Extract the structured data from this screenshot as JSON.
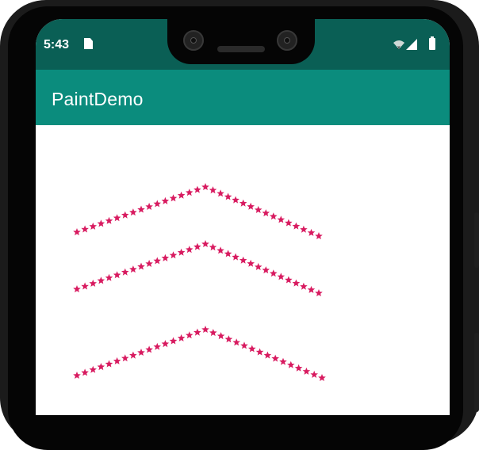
{
  "status_bar": {
    "time": "5:43",
    "icons": [
      "sim-card-icon",
      "wifi-icon",
      "signal-icon",
      "battery-icon"
    ]
  },
  "app_bar": {
    "title": "PaintDemo",
    "color": "#0b8c7d",
    "status_color": "#0a5f55"
  },
  "canvas": {
    "star_color": "#d81b60",
    "paths": [
      "upper-star-path",
      "middle-star-path",
      "lower-star-path"
    ]
  }
}
